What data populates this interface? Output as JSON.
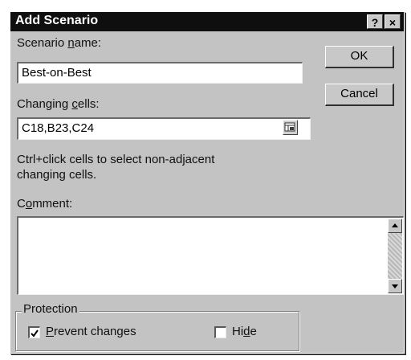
{
  "window": {
    "title": "Add Scenario",
    "help_btn": "?",
    "close_btn": "×"
  },
  "scenario_name": {
    "label_prefix": "Scenario ",
    "label_key": "n",
    "label_suffix": "ame:",
    "value": "Best-on-Best"
  },
  "changing_cells": {
    "label_prefix": "Changing ",
    "label_key": "c",
    "label_suffix": "ells:",
    "value": "C18,B23,C24",
    "hint_line1": "Ctrl+click cells to select non-adjacent",
    "hint_line2": "changing cells."
  },
  "comment": {
    "label_prefix": "C",
    "label_key": "o",
    "label_suffix": "mment:",
    "value": ""
  },
  "buttons": {
    "ok": "OK",
    "cancel": "Cancel"
  },
  "protection": {
    "title": "Protection",
    "prevent_prefix": "",
    "prevent_key": "P",
    "prevent_suffix": "revent changes",
    "prevent_checked": true,
    "hide_prefix": "Hi",
    "hide_key": "d",
    "hide_suffix": "e",
    "hide_checked": false
  }
}
